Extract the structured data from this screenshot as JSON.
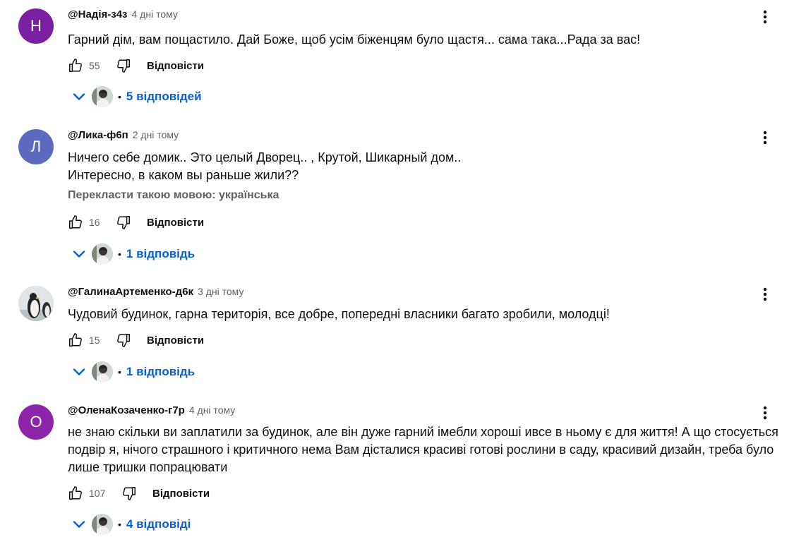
{
  "comments": [
    {
      "author": "@Надія-з4з",
      "time": "4 дні тому",
      "avatar_letter": "Н",
      "avatar_color": "#7b1fa2",
      "lines": [
        "Гарний дім, вам пощастило. Дай Боже, щоб усім біженцям було щастя... сама така...Рада за вас!"
      ],
      "likes": "55",
      "reply_label": "Відповісти",
      "replies_label": "5 відповідей"
    },
    {
      "author": "@Лика-ф6п",
      "time": "2 дні тому",
      "avatar_letter": "Л",
      "avatar_color": "#5c6bc0",
      "lines": [
        "Ничего себе домик.. Это целый Дворец.. , Крутой, Шикарный дом..",
        "Интересно, в каком вы раньше жили??"
      ],
      "translate": "Перекласти такою мовою: українська",
      "likes": "16",
      "reply_label": "Відповісти",
      "replies_label": "1 відповідь"
    },
    {
      "author": "@ГалинаАртеменко-д6к",
      "time": "3 дні тому",
      "avatar_icon": "penguin-avatar-icon",
      "lines": [
        "Чудовий будинок, гарна територія, все добре, попередні власники багато зробили, молодці!"
      ],
      "likes": "15",
      "reply_label": "Відповісти",
      "replies_label": "1 відповідь"
    },
    {
      "author": "@ОленаКозаченко-г7р",
      "time": "4 дні тому",
      "avatar_letter": "О",
      "avatar_color": "#8e24aa",
      "lines": [
        "не знаю скільки ви заплатили за будинок, але він дуже гарний імебли хороші ивсе в ньому є для життя! А що стосується",
        "подвір я, нічого страшного і критичного нема Вам дісталися красиві готові рослини в саду, красивий дизайн, треба було",
        "лише тришки попрацювати"
      ],
      "likes": "107",
      "reply_label": "Відповісти",
      "replies_label": "4 відповіді"
    }
  ],
  "colors": {
    "link": "#065fd4",
    "secondary": "#606060"
  },
  "icons": [
    "like-icon",
    "dislike-icon",
    "more-vertical-icon",
    "chevron-down-icon"
  ]
}
